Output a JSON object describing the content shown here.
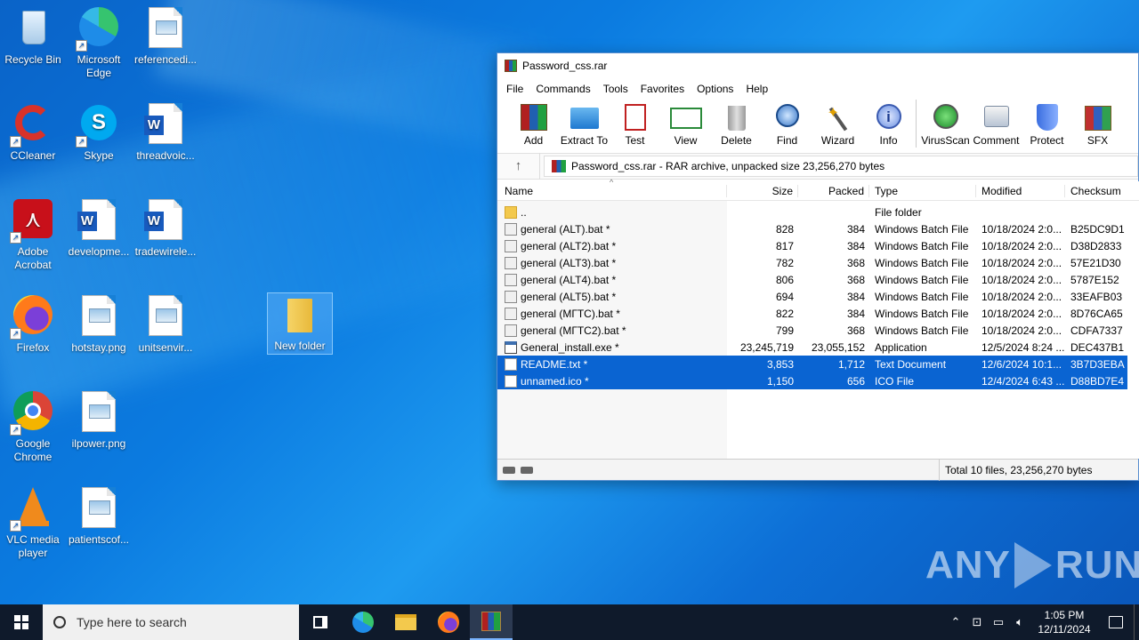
{
  "desktop": {
    "icons": [
      {
        "label": "Recycle Bin"
      },
      {
        "label": "Microsoft Edge"
      },
      {
        "label": "referencedi..."
      },
      {
        "label": "CCleaner"
      },
      {
        "label": "Skype"
      },
      {
        "label": "threadvoic..."
      },
      {
        "label": "Adobe Acrobat"
      },
      {
        "label": "developme..."
      },
      {
        "label": "tradewirele..."
      },
      {
        "label": "Firefox"
      },
      {
        "label": "hotstay.png"
      },
      {
        "label": "unitsenvir..."
      },
      {
        "label": "New folder"
      },
      {
        "label": "Google Chrome"
      },
      {
        "label": "ilpower.png"
      },
      {
        "label": "VLC media player"
      },
      {
        "label": "patientscof..."
      }
    ]
  },
  "winrar": {
    "title": "Password_css.rar",
    "menu": [
      "File",
      "Commands",
      "Tools",
      "Favorites",
      "Options",
      "Help"
    ],
    "toolbar": [
      "Add",
      "Extract To",
      "Test",
      "View",
      "Delete",
      "Find",
      "Wizard",
      "Info",
      "VirusScan",
      "Comment",
      "Protect",
      "SFX"
    ],
    "address": "Password_css.rar - RAR archive, unpacked size 23,256,270 bytes",
    "columns": {
      "name": "Name",
      "size": "Size",
      "packed": "Packed",
      "type": "Type",
      "modified": "Modified",
      "checksum": "Checksum"
    },
    "rows": [
      {
        "name": "..",
        "size": "",
        "packed": "",
        "type": "File folder",
        "modified": "",
        "checksum": "",
        "icon": "folder"
      },
      {
        "name": "general (ALT).bat *",
        "size": "828",
        "packed": "384",
        "type": "Windows Batch File",
        "modified": "10/18/2024 2:0...",
        "checksum": "B25DC9D1",
        "icon": "bat"
      },
      {
        "name": "general (ALT2).bat *",
        "size": "817",
        "packed": "384",
        "type": "Windows Batch File",
        "modified": "10/18/2024 2:0...",
        "checksum": "D38D2833",
        "icon": "bat"
      },
      {
        "name": "general (ALT3).bat *",
        "size": "782",
        "packed": "368",
        "type": "Windows Batch File",
        "modified": "10/18/2024 2:0...",
        "checksum": "57E21D30",
        "icon": "bat"
      },
      {
        "name": "general (ALT4).bat *",
        "size": "806",
        "packed": "368",
        "type": "Windows Batch File",
        "modified": "10/18/2024 2:0...",
        "checksum": "5787E152",
        "icon": "bat"
      },
      {
        "name": "general (ALT5).bat *",
        "size": "694",
        "packed": "384",
        "type": "Windows Batch File",
        "modified": "10/18/2024 2:0...",
        "checksum": "33EAFB03",
        "icon": "bat"
      },
      {
        "name": "general (МГТС).bat *",
        "size": "822",
        "packed": "384",
        "type": "Windows Batch File",
        "modified": "10/18/2024 2:0...",
        "checksum": "8D76CA65",
        "icon": "bat"
      },
      {
        "name": "general (МГТС2).bat *",
        "size": "799",
        "packed": "368",
        "type": "Windows Batch File",
        "modified": "10/18/2024 2:0...",
        "checksum": "CDFA7337",
        "icon": "bat"
      },
      {
        "name": "General_install.exe *",
        "size": "23,245,719",
        "packed": "23,055,152",
        "type": "Application",
        "modified": "12/5/2024 8:24 ...",
        "checksum": "DEC437B1",
        "icon": "exe"
      },
      {
        "name": "README.txt *",
        "size": "3,853",
        "packed": "1,712",
        "type": "Text Document",
        "modified": "12/6/2024 10:1...",
        "checksum": "3B7D3EBA",
        "icon": "txt",
        "selected": true
      },
      {
        "name": "unnamed.ico *",
        "size": "1,150",
        "packed": "656",
        "type": "ICO File",
        "modified": "12/4/2024 6:43 ...",
        "checksum": "D88BD7E4",
        "icon": "ico",
        "selected": true
      }
    ],
    "status": "Total 10 files, 23,256,270 bytes"
  },
  "watermark": {
    "left": "ANY",
    "right": "RUN"
  },
  "taskbar": {
    "search_placeholder": "Type here to search",
    "time": "1:05 PM",
    "date": "12/11/2024"
  },
  "colors": {
    "accent": "#0a64d2",
    "taskbar": "#0f1a2b"
  }
}
